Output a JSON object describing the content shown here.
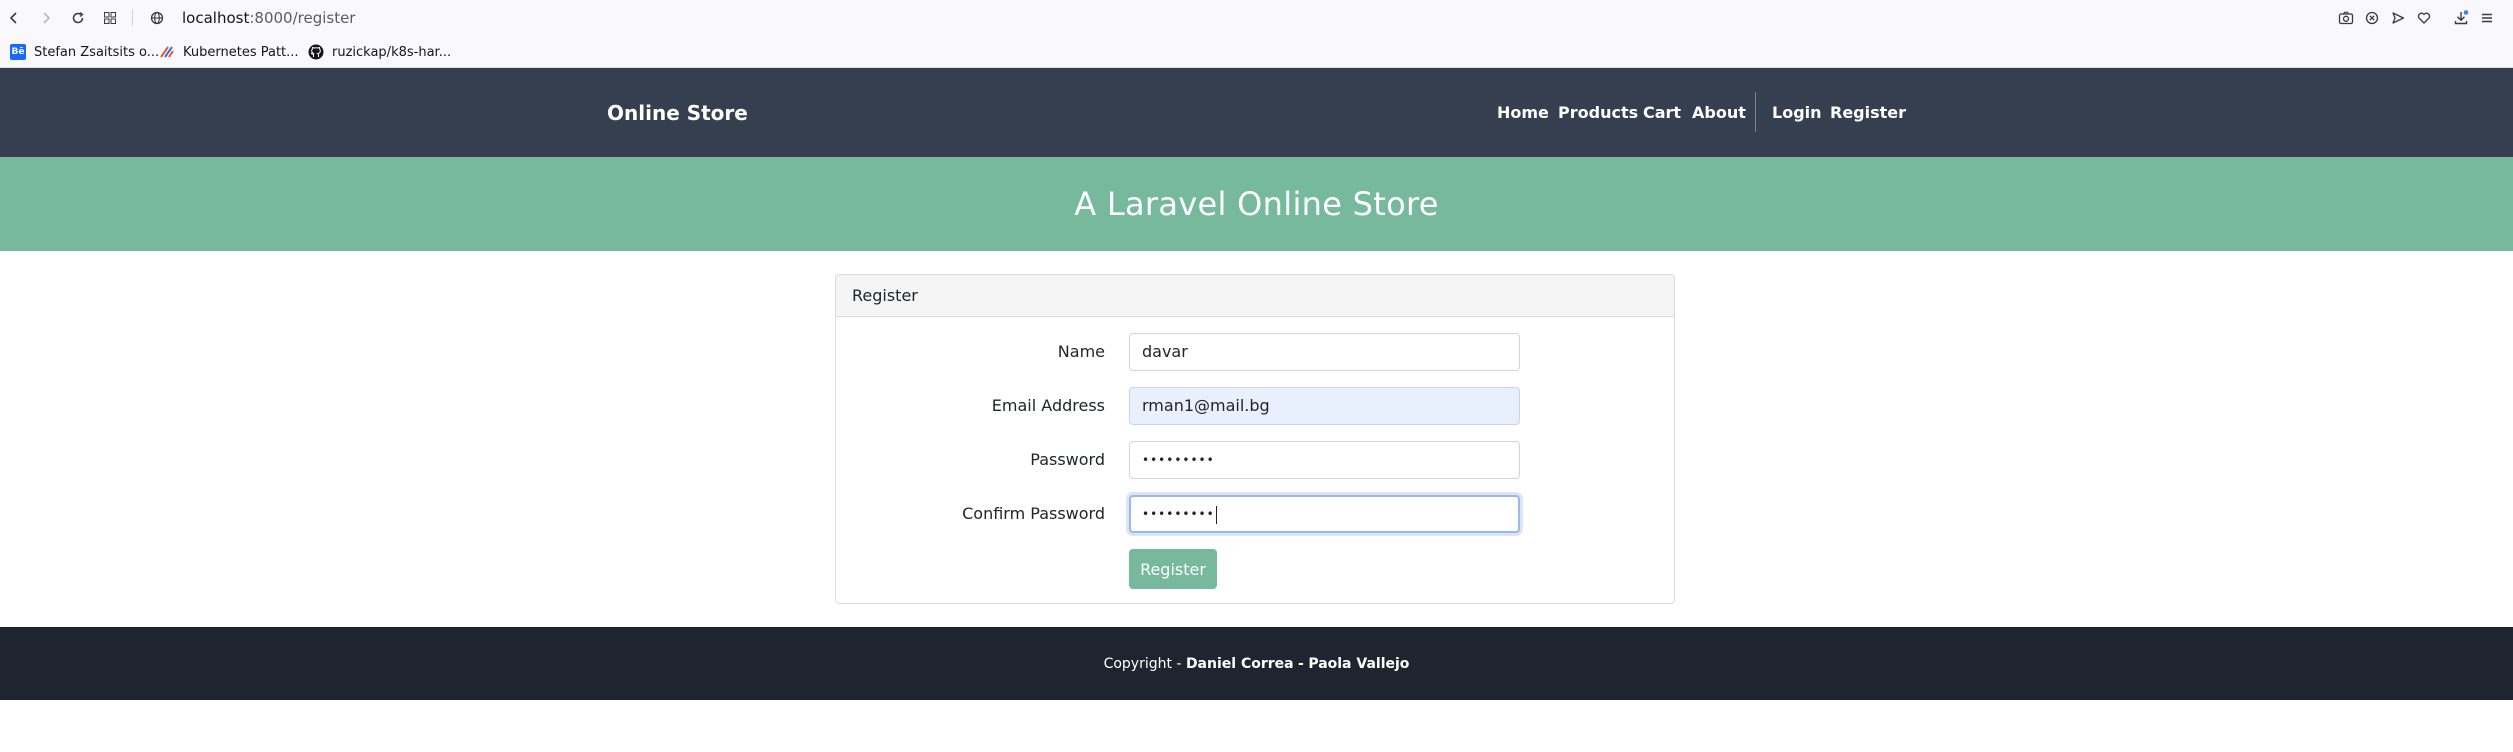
{
  "browser": {
    "url_host": "localhost",
    "url_path": ":8000/register",
    "bookmarks": [
      {
        "label": "Stefan Zsaitsits o...",
        "icon": "behance-icon"
      },
      {
        "label": "Kubernetes Patt...",
        "icon": "kubernetes-icon"
      },
      {
        "label": "ruzickap/k8s-har...",
        "icon": "github-icon"
      }
    ]
  },
  "navbar": {
    "brand": "Online Store",
    "links": [
      "Home",
      "Products",
      "Cart",
      "About"
    ],
    "auth_links": [
      "Login",
      "Register"
    ]
  },
  "hero": {
    "title": "A Laravel Online Store"
  },
  "register_form": {
    "header": "Register",
    "name_label": "Name",
    "name_value": "davar",
    "email_label": "Email Address",
    "email_value": "rman1@mail.bg",
    "password_label": "Password",
    "password_value": "•••••••••",
    "confirm_label": "Confirm Password",
    "confirm_value": "•••••••••",
    "submit_label": "Register"
  },
  "footer": {
    "prefix": "Copyright -",
    "author1": "Daniel Correa",
    "separator": "-",
    "author2": "Paola Vallejo"
  }
}
